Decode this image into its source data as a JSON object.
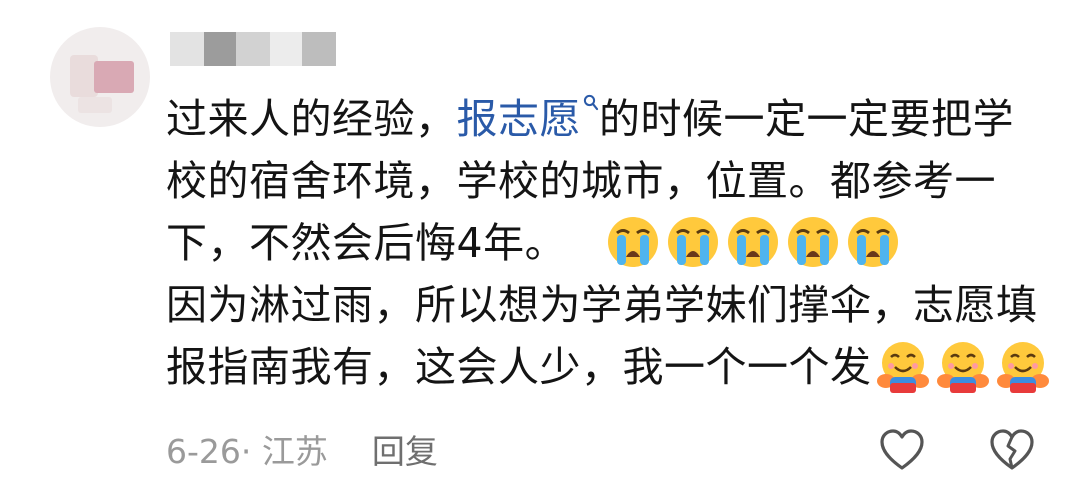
{
  "comment": {
    "lines": [
      {
        "before": "过来人的经验，",
        "link": "报志愿",
        "after": "的时候一定一定要把学"
      },
      {
        "text": "校的宿舍环境，学校的城市，位置。都参考一"
      },
      {
        "text": "下，不然会后悔4年。"
      },
      {
        "text": "因为淋过雨，所以想为学弟学妹们撑伞，志愿填"
      },
      {
        "text": "报指南我有，这会人少，我一个一个发"
      }
    ],
    "emojis_line3": [
      "crying-face",
      "crying-face",
      "crying-face",
      "crying-face",
      "crying-face"
    ],
    "emojis_line5": [
      "hugging-face",
      "hugging-face",
      "hugging-face"
    ]
  },
  "meta": {
    "date_location": "6-26· 江苏",
    "reply_label": "回复"
  },
  "colors": {
    "link": "#2a5aa8",
    "text": "#141414",
    "meta": "#9a9a9a"
  },
  "icons": {
    "like": "heart-outline-icon",
    "dislike": "broken-heart-outline-icon",
    "search": "search-icon"
  }
}
